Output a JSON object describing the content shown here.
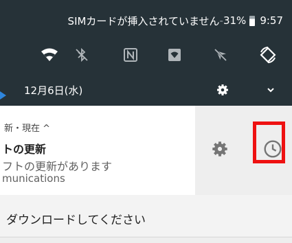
{
  "status_bar": {
    "sim_text": "SIMカードが挿入されていません",
    "separator": "-",
    "battery": "31%",
    "time": "9:57"
  },
  "quick_settings": {
    "tiles": [
      "wifi-icon",
      "bluetooth-off-icon",
      "nfc-icon",
      "hotspot-icon",
      "location-off-icon",
      "auto-rotate-icon"
    ]
  },
  "date_row": {
    "date": "12月6日(水)"
  },
  "notification": {
    "header": "新・現在 ^",
    "title": "トの更新",
    "text": "フトの更新があります",
    "app": "munications"
  },
  "snooze": {
    "settings_icon": "gear-icon",
    "snooze_icon": "clock-icon"
  },
  "notification2": {
    "text": "ダウンロードしてください"
  },
  "colors": {
    "shade": "#263238",
    "highlight": "#ee1111",
    "pointer": "#2e86de"
  }
}
